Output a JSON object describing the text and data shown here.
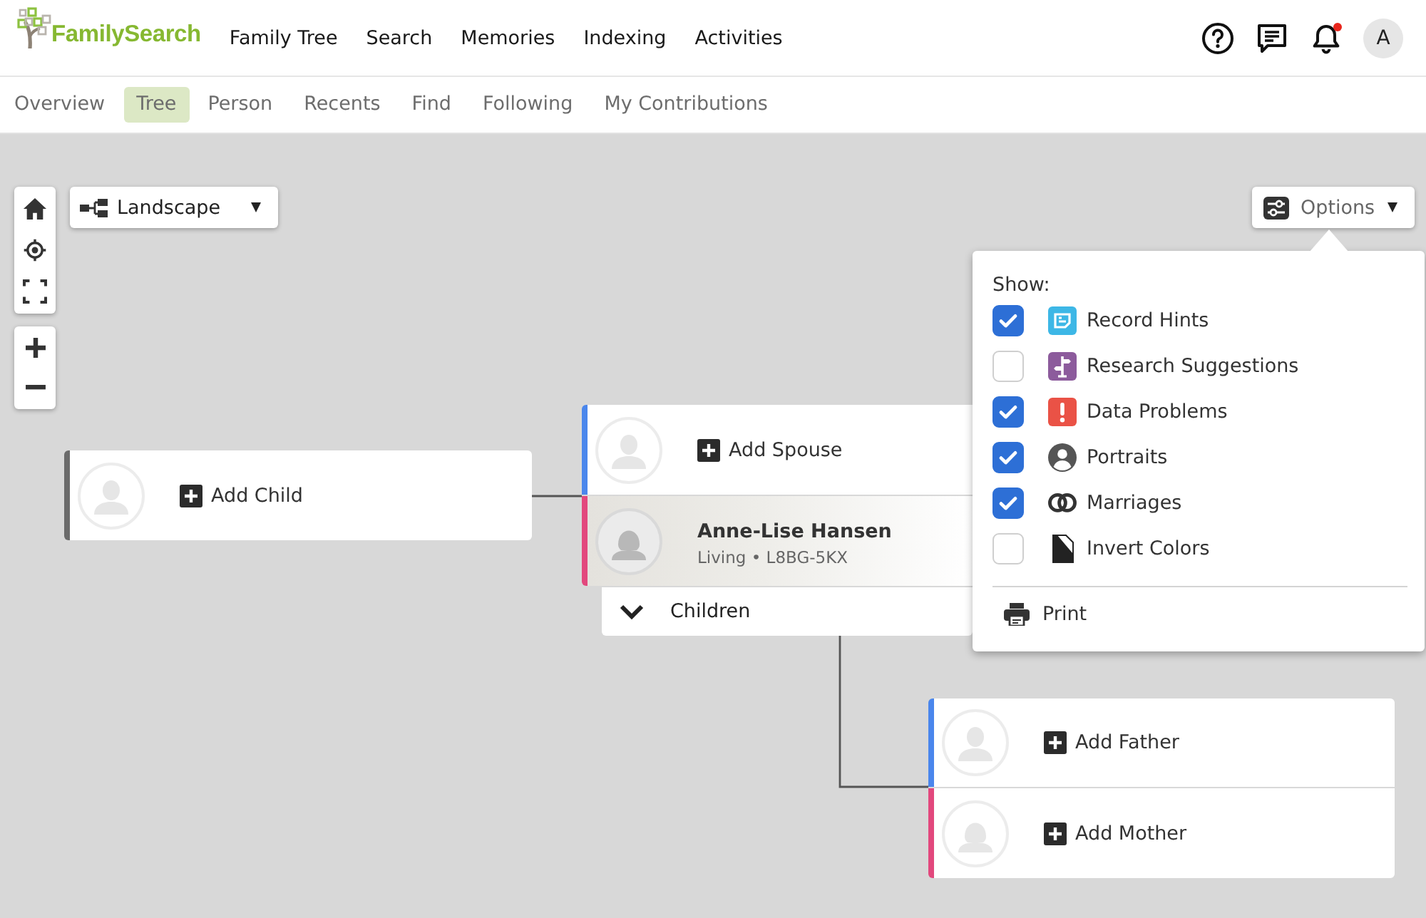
{
  "header": {
    "logo": "FamilySearch",
    "nav": [
      "Family Tree",
      "Search",
      "Memories",
      "Indexing",
      "Activities"
    ],
    "notifications": {
      "unread": true
    },
    "avatar": "A"
  },
  "subnav": [
    {
      "label": "Overview",
      "selected": false
    },
    {
      "label": "Tree",
      "selected": true
    },
    {
      "label": "Person",
      "selected": false
    },
    {
      "label": "Recents",
      "selected": false
    },
    {
      "label": "Find",
      "selected": false
    },
    {
      "label": "Following",
      "selected": false
    },
    {
      "label": "My Contributions",
      "selected": false
    }
  ],
  "toolbar": {
    "view": "Landscape",
    "options": "Options"
  },
  "options_menu": {
    "heading": "Show:",
    "items": [
      {
        "kind": "record_hints",
        "label": "Record Hints",
        "checked": true
      },
      {
        "kind": "research_suggestions",
        "label": "Research Suggestions",
        "checked": false
      },
      {
        "kind": "data_problems",
        "label": "Data Problems",
        "checked": true
      },
      {
        "kind": "portraits",
        "label": "Portraits",
        "checked": true
      },
      {
        "kind": "marriages",
        "label": "Marriages",
        "checked": true
      },
      {
        "kind": "invert_colors",
        "label": "Invert Colors",
        "checked": false
      }
    ],
    "print": "Print"
  },
  "tree": {
    "child": {
      "kind": "unknown",
      "action": "Add Child"
    },
    "spouse": {
      "kind": "male",
      "action": "Add Spouse"
    },
    "focus": {
      "kind": "female",
      "name": "Anne-Lise Hansen",
      "details": "Living • L8BG-5KX"
    },
    "children_toggle": {
      "label": "Children",
      "expanded": true
    },
    "father": {
      "kind": "male",
      "action": "Add Father"
    },
    "mother": {
      "kind": "female",
      "action": "Add Mother"
    }
  }
}
